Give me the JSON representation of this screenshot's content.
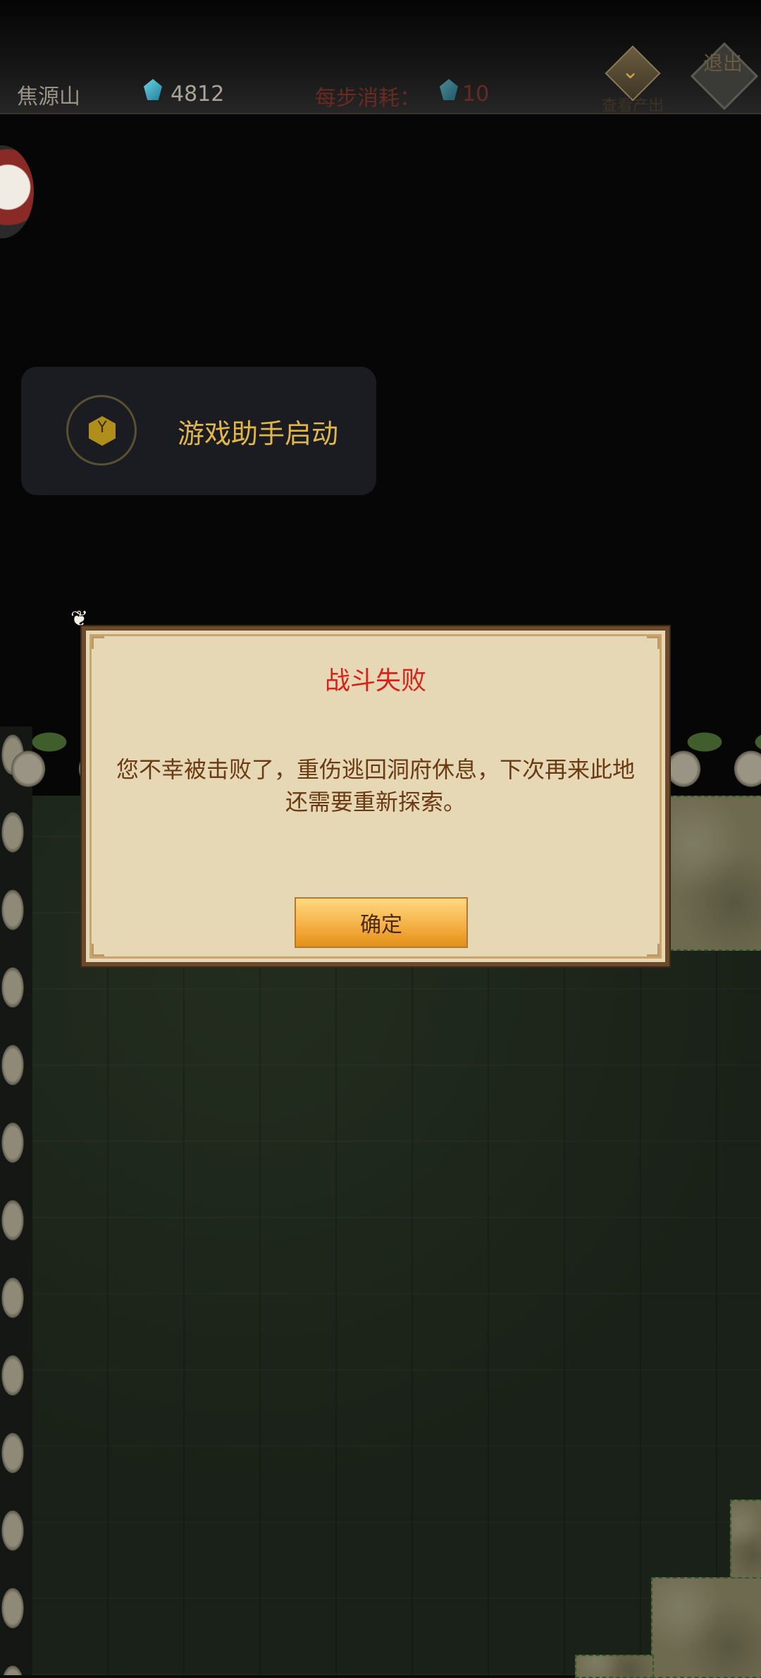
{
  "top_bar": {
    "location": "焦源山",
    "spirit_stones": "4812",
    "cost_label": "每步消耗：",
    "cost_value": "10",
    "view_output": "查看产出",
    "exit": "退出"
  },
  "helper_toast": {
    "text": "游戏助手启动"
  },
  "dialog": {
    "title": "战斗失败",
    "message": "您不幸被击败了，重伤逃回洞府休息，下次再来此地还需要重新探索。",
    "confirm": "确定"
  },
  "icons": [
    "spirit-stone-icon",
    "chevron-down-icon",
    "helper-cube-icon",
    "avatar-icon"
  ],
  "colors": {
    "title_red": "#d8221b",
    "helper_gold": "#e0b64a",
    "confirm_orange": "#f2a636",
    "parchment": "#e6d8b4"
  }
}
